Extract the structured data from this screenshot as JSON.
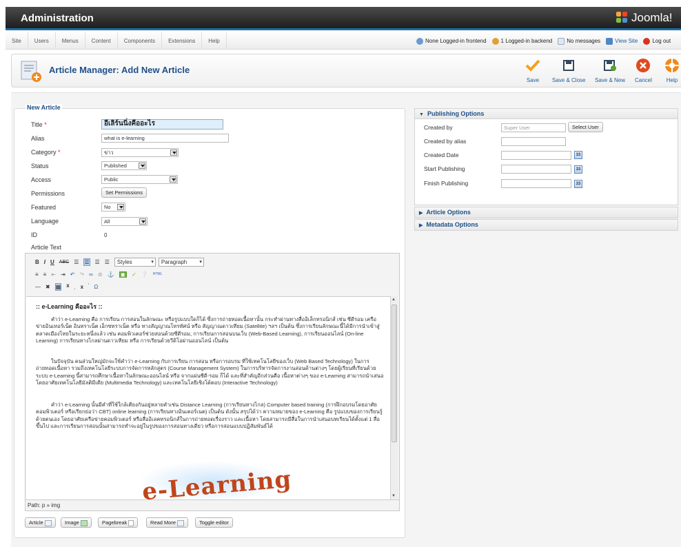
{
  "header": {
    "title": "Administration",
    "brand": "Joomla!"
  },
  "menu": {
    "items": [
      "Site",
      "Users",
      "Menus",
      "Content",
      "Components",
      "Extensions",
      "Help"
    ]
  },
  "status": {
    "frontend": "None Logged-in frontend",
    "backend": "1 Logged-in backend",
    "messages": "No messages",
    "view_site": "View Site",
    "logout": "Log out"
  },
  "toolbar": {
    "heading": "Article Manager: Add New Article",
    "save": "Save",
    "save_close": "Save & Close",
    "save_new": "Save & New",
    "cancel": "Cancel",
    "help": "Help"
  },
  "form": {
    "legend": "New Article",
    "title_label": "Title",
    "title_value": "อีเลิร์นนิ่งคืออะไร",
    "alias_label": "Alias",
    "alias_value": "what is e-learning",
    "category_label": "Category",
    "category_value": "ข่าว",
    "status_label": "Status",
    "status_value": "Published",
    "access_label": "Access",
    "access_value": "Public",
    "permissions_label": "Permissions",
    "permissions_button": "Set Permissions",
    "featured_label": "Featured",
    "featured_value": "No",
    "language_label": "Language",
    "language_value": "All",
    "id_label": "ID",
    "id_value": "0",
    "article_text_label": "Article Text"
  },
  "editor": {
    "styles": "Styles",
    "format": "Paragraph",
    "heading": ":: e-Learning คืออะไร ::",
    "paragraphs": [
      "คำว่า e-Learning คือ การเรียน การสอนในลักษณะ หรือรูปแบบใดก็ได้ ซึ่งการถ่ายทอดเนื้อหานั้น กระทำผ่านทางสื่ออิเล็กทรอนิกส์ เช่น ซีดีรอม เครือข่ายอินเทอร์เน็ต อินทราเน็ต เอ็กซทราเน็ต หรือ ทางสัญญาณโทรทัศน์ หรือ สัญญาณดาวเทียม (Satellite) ฯลฯ เป็นต้น ซึ่งการเรียนลักษณะนี้ได้มีการนำเข้าสู่ตลาดเมืองไทยในระยะหนึ่งแล้ว เช่น คอมพิวเตอร์ช่วยสอนด้วยซีดีรอม, การเรียนการสอนบนเว็บ (Web-Based Learning), การเรียนออนไลน์ (On-line Learning) การเรียนทางไกลผ่านดาวเทียม หรือ การเรียนด้วยวีดิโอผ่านออนไลน์ เป็นต้น",
      "ในปัจจุบัน คนส่วนใหญ่มักจะใช้คำว่า e-Learning กับการเรียน การสอน หรือการอบรม ที่ใช้เทคโนโลยีของเว็บ (Web Based Technology) ในการถ่ายทอดเนื้อหา รวมถึงเทคโนโลยีระบบการจัดการหลักสูตร (Course Management System) ในการบริหารจัดการงานสอนด้านต่างๆ โดยผู้เรียนที่เรียนด้วยระบบ e-Learning นี้สามารถศึกษาเนื้อหาในลักษณะออนไลน์ หรือ จากแผ่นซีดี-รอม ก็ได้ และที่สำคัญอีกส่วนคือ เนื้อหาต่างๆ ของ e-Learning สามารถนำเสนอโดยอาศัยเทคโนโลยีมัลติมีเดีย (Multimedia Technology) และเทคโนโลยีเชิงโต้ตอบ (Interactive Technology)",
      "คำว่า e-Learning นั้นมีคำที่ใช้ใกล้เคียงกันอยู่หลายคำเช่น Distance Learning (การเรียนทางไกล) Computer based training (การฝึกอบรมโดยอาศัยคอมพิวเตอร์ หรือเรียกย่อว่า CBT) online learning (การเรียนทางอินเตอร์เนต) เป็นต้น ดังนั้น สรุปได้ว่า ความหมายของ e-Learning คือ รูปแบบของการเรียนรู้ด้วยตนเอง โดยอาศัยเครือข่ายคอมพิวเตอร์ หรือสื่ออิเลคทรอนิกส์ในการถ่ายทอดเรื่องราว และเนื้อหา โดยสามารถมีสื่อในการนำเสนอบทเรียนได้ตั้งแต่ 1 สื่อขึ้นไป และการเรียนการสอนนั้นสามารถทำจะอยู่ในรูปของการสอนทางเดียว หรือการสอนแบบปฏิสัมพันธ์ได้"
    ],
    "image_text": "e-Learning",
    "path": "Path: p » img"
  },
  "editor_buttons": [
    "Article",
    "Image",
    "Pagebreak",
    "Read More",
    "Toggle editor"
  ],
  "publishing": {
    "header": "Publishing Options",
    "created_by": "Created by",
    "created_by_placeholder": "Super User",
    "select_user": "Select User",
    "created_by_alias": "Created by alias",
    "created_date": "Created Date",
    "start_publishing": "Start Publishing",
    "finish_publishing": "Finish Publishing"
  },
  "article_options": "Article Options",
  "metadata_options": "Metadata Options",
  "colors": {
    "header_blue": "#1f4f87",
    "topbar": "#2b2b2b",
    "accent_line": "#1c6ea4"
  }
}
